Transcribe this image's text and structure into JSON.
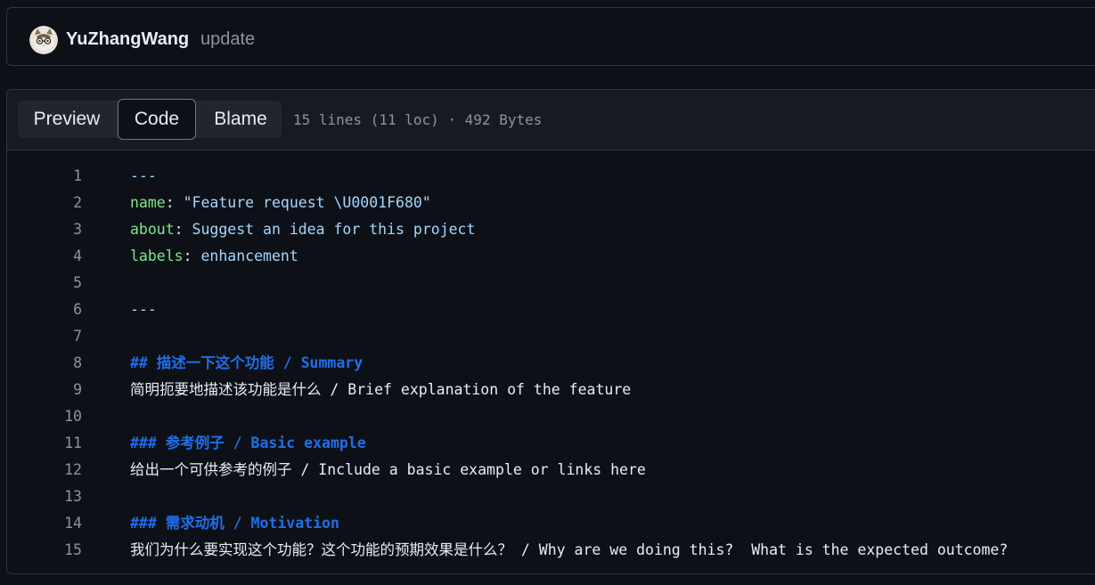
{
  "commit": {
    "author": "YuZhangWang",
    "message": "update"
  },
  "tabs": {
    "preview": "Preview",
    "code": "Code",
    "blame": "Blame"
  },
  "file_meta": "15 lines (11 loc) · 492 Bytes",
  "lines": [
    {
      "n": "1",
      "parts": [
        {
          "c": "d",
          "t": "---"
        }
      ]
    },
    {
      "n": "2",
      "parts": [
        {
          "c": "k",
          "t": "name"
        },
        {
          "c": "p",
          "t": ": "
        },
        {
          "c": "s",
          "t": "\"Feature request \\U0001F680\""
        }
      ]
    },
    {
      "n": "3",
      "parts": [
        {
          "c": "k",
          "t": "about"
        },
        {
          "c": "p",
          "t": ": "
        },
        {
          "c": "s",
          "t": "Suggest an idea for this project"
        }
      ]
    },
    {
      "n": "4",
      "parts": [
        {
          "c": "k",
          "t": "labels"
        },
        {
          "c": "p",
          "t": ": "
        },
        {
          "c": "s",
          "t": "enhancement"
        }
      ]
    },
    {
      "n": "5",
      "parts": []
    },
    {
      "n": "6",
      "parts": [
        {
          "c": "d",
          "t": "---"
        }
      ]
    },
    {
      "n": "7",
      "parts": []
    },
    {
      "n": "8",
      "parts": [
        {
          "c": "h",
          "t": "## 描述一下这个功能 / Summary"
        }
      ]
    },
    {
      "n": "9",
      "parts": [
        {
          "c": "p",
          "t": "简明扼要地描述该功能是什么 / Brief explanation of the feature"
        }
      ]
    },
    {
      "n": "10",
      "parts": []
    },
    {
      "n": "11",
      "parts": [
        {
          "c": "h",
          "t": "### 参考例子 / Basic example"
        }
      ]
    },
    {
      "n": "12",
      "parts": [
        {
          "c": "p",
          "t": "给出一个可供参考的例子 / Include a basic example or links here"
        }
      ]
    },
    {
      "n": "13",
      "parts": []
    },
    {
      "n": "14",
      "parts": [
        {
          "c": "h",
          "t": "### 需求动机 / Motivation"
        }
      ]
    },
    {
      "n": "15",
      "parts": [
        {
          "c": "p",
          "t": "我们为什么要实现这个功能？这个功能的预期效果是什么？ / Why are we doing this?  What is the expected outcome?"
        }
      ]
    }
  ]
}
